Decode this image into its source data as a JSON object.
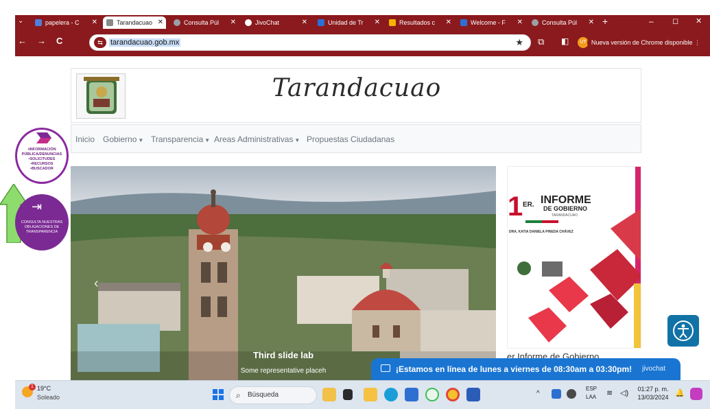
{
  "browser": {
    "tabs": [
      {
        "title": "papelera - C",
        "color": "#4f7fd8",
        "active": false
      },
      {
        "title": "Tarandacuao",
        "color": "#8a8a8a",
        "active": true
      },
      {
        "title": "Consulta Púl",
        "color": "#9aa0a6",
        "active": false
      },
      {
        "title": "JivoChat",
        "color": "#222222",
        "active": false
      },
      {
        "title": "Unidad de Tr",
        "color": "#2c6fd6",
        "active": false
      },
      {
        "title": "Resultados c",
        "color": "#f4b400",
        "active": false
      },
      {
        "title": "Welcome - F",
        "color": "#2c6fd6",
        "active": false
      },
      {
        "title": "Consulta Púl",
        "color": "#9aa0a6",
        "active": false
      }
    ],
    "new_tab": "+",
    "minimize": "–",
    "restore": "◻",
    "close": "✕",
    "back": "←",
    "forward": "→",
    "reload": "C",
    "url": "tarandacuao.gob.mx",
    "update_label": "Nueva versión de Chrome disponible",
    "profile_initials": "UT"
  },
  "site": {
    "title": "Tarandacuao",
    "nav": [
      {
        "label": "Inicio",
        "dropdown": false
      },
      {
        "label": "Gobierno",
        "dropdown": true
      },
      {
        "label": "Transparencia",
        "dropdown": true
      },
      {
        "label": "Areas Administrativas",
        "dropdown": true
      },
      {
        "label": "Propuestas Ciudadanas",
        "dropdown": false
      }
    ],
    "float_info": {
      "lines": [
        "•INFORMACIÓN",
        "PÚBLICA/DENUNCIAS",
        "•SOLICITUDES",
        "•RECURSOS",
        "•BUSCADOR"
      ]
    },
    "float_transparencia": {
      "lines": [
        "CONSULTA NUESTRAS",
        "OBLIGACIONES DE",
        "TRANSPARENCIA"
      ]
    },
    "carousel": {
      "caption_title": "Third slide lab",
      "caption_text": "Some representative placeh",
      "prev_label": "‹"
    },
    "side_banner": {
      "number": "1",
      "er": "ER.",
      "informe": "INFORME",
      "de_gobierno": "DE GOBIERNO",
      "municipio": "TARANDACUAO",
      "presidenta": "DRA. KATIA DANIELA PINEDA CHÁVEZ",
      "caption": "er Informe de Gobierno"
    },
    "chat": {
      "message": "¡Estamos en línea de lunes a viernes de 08:30am a 03:30pm!",
      "brand": "jivochat"
    }
  },
  "taskbar": {
    "weather_temp": "19°C",
    "weather_cond": "Soleado",
    "weather_badge": "1",
    "search_placeholder": "Búsqueda",
    "lang_top": "ESP",
    "lang_bottom": "LAA",
    "time": "01:27 p. m.",
    "date": "13/03/2024"
  },
  "colors": {
    "browser_frame": "#8a1a1d",
    "float_purple": "#7b2a94",
    "chat_blue": "#1a75d2",
    "a11y_blue": "#1172a6"
  }
}
